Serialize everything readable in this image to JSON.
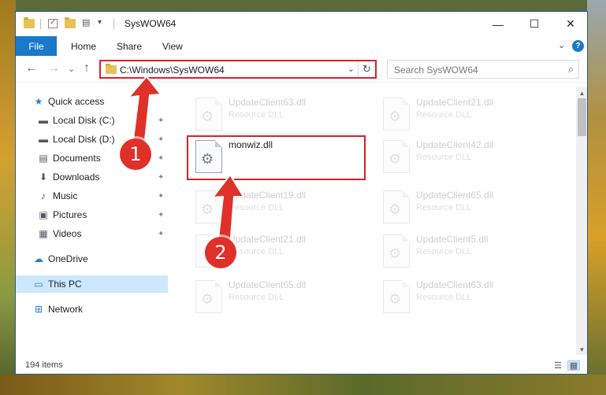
{
  "window": {
    "title": "SysWOW64",
    "controls": {
      "minimize": "—",
      "maximize": "☐",
      "close": "✕"
    }
  },
  "ribbon": {
    "file_tab": "File",
    "tabs": [
      "Home",
      "Share",
      "View"
    ],
    "expand_glyph": "⌄",
    "help_glyph": "?"
  },
  "navigation": {
    "back": "←",
    "forward": "→",
    "recent": "⌄",
    "up": "↑",
    "address": "C:\\Windows\\SysWOW64",
    "address_dropdown": "⌄",
    "refresh": "↻",
    "search_placeholder": "Search SysWOW64",
    "search_icon": "⌕"
  },
  "sidebar": {
    "items": [
      {
        "label": "Quick access",
        "icon": "star-icon",
        "glyph": "★",
        "pinned": false
      },
      {
        "label": "Local Disk (C:)",
        "icon": "drive-icon",
        "glyph": "▬",
        "pinned": true
      },
      {
        "label": "Local Disk (D:)",
        "icon": "drive-icon",
        "glyph": "▬",
        "pinned": true
      },
      {
        "label": "Documents",
        "icon": "documents-icon",
        "glyph": "▤",
        "pinned": true
      },
      {
        "label": "Downloads",
        "icon": "downloads-icon",
        "glyph": "⬇",
        "pinned": true
      },
      {
        "label": "Music",
        "icon": "music-icon",
        "glyph": "♪",
        "pinned": true
      },
      {
        "label": "Pictures",
        "icon": "pictures-icon",
        "glyph": "▣",
        "pinned": true
      },
      {
        "label": "Videos",
        "icon": "videos-icon",
        "glyph": "▦",
        "pinned": true
      },
      {
        "label": "OneDrive",
        "icon": "cloud-icon",
        "glyph": "☁",
        "pinned": false
      },
      {
        "label": "This PC",
        "icon": "computer-icon",
        "glyph": "▭",
        "pinned": false,
        "selected": true
      },
      {
        "label": "Network",
        "icon": "network-icon",
        "glyph": "⊞",
        "pinned": false
      }
    ],
    "pin_glyph": "📌"
  },
  "files": {
    "left_column": [
      {
        "name": "UpdateClient63.dll",
        "type": "Resource DLL",
        "faded": true
      },
      {
        "name": "monwiz.dll",
        "type": "",
        "faded": false,
        "highlighted": true
      },
      {
        "name": "UpdateClient19.dll",
        "type": "Resource DLL",
        "faded": true
      },
      {
        "name": "UpdateClient21.dll",
        "type": "Resource DLL",
        "faded": true
      },
      {
        "name": "UpdateClient65.dll",
        "type": "Resource DLL",
        "faded": true
      }
    ],
    "right_column": [
      {
        "name": "UpdateClient21.dll",
        "type": "Resource DLL",
        "faded": true
      },
      {
        "name": "UpdateClient42.dll",
        "type": "Resource DLL",
        "faded": true
      },
      {
        "name": "UpdateClient65.dll",
        "type": "Resource DLL",
        "faded": true
      },
      {
        "name": "UpdateClient5.dll",
        "type": "Resource DLL",
        "faded": true
      },
      {
        "name": "UpdateClient63.dll",
        "type": "Resource DLL",
        "faded": true
      }
    ],
    "gear_glyph": "⚙"
  },
  "status": {
    "item_count": "194 items",
    "details_view_glyph": "☰",
    "icons_view_glyph": "▦"
  },
  "annotations": {
    "step1": "1",
    "step2": "2",
    "color": "#e0302a"
  },
  "scrollbar": {
    "up": "▲",
    "down": "▼"
  }
}
